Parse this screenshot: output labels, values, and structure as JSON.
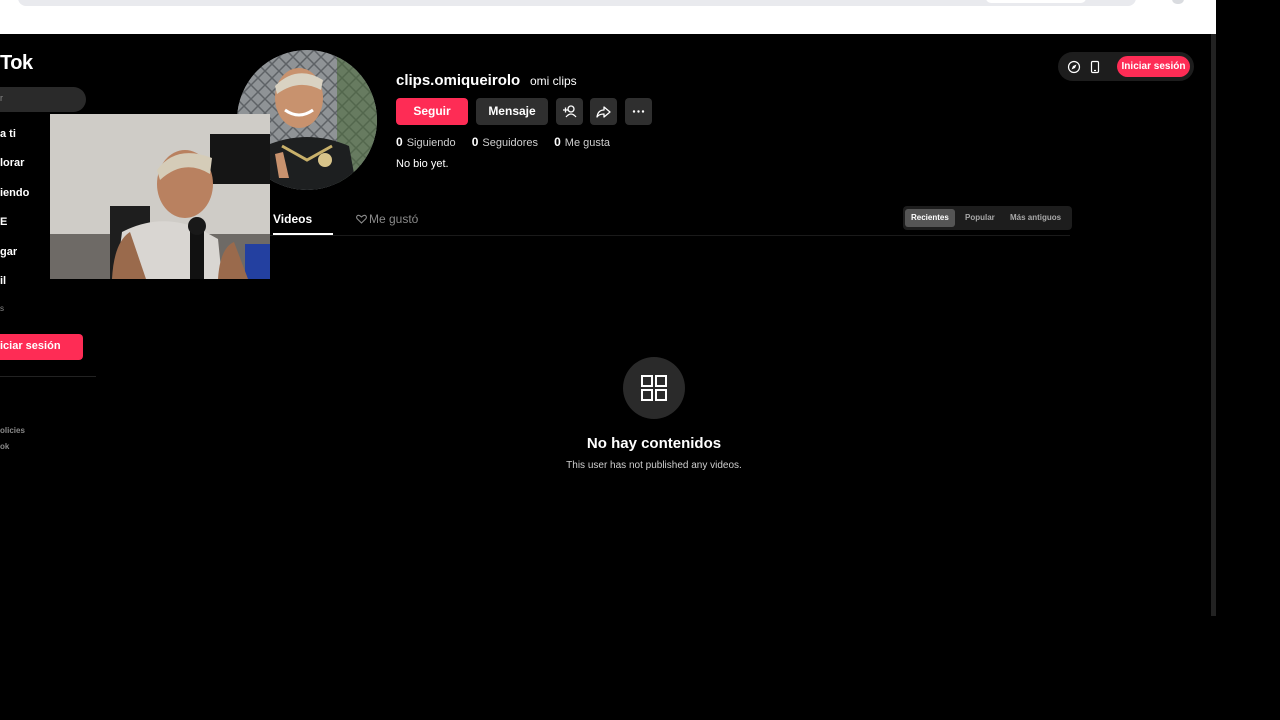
{
  "sidebar": {
    "logo": "Tok",
    "search_placeholder": "r",
    "items": [
      {
        "label": "a ti"
      },
      {
        "label": "lorar"
      },
      {
        "label": "iendo"
      },
      {
        "label": "E"
      },
      {
        "label": "gar"
      },
      {
        "label": "il"
      },
      {
        "label": "s"
      }
    ],
    "login_label": "iciar sesión",
    "footer": [
      {
        "label": "olicies"
      },
      {
        "label": "ok"
      }
    ]
  },
  "profile": {
    "username": "clips.omiqueirolo",
    "nickname": "omi clips",
    "follow_label": "Seguir",
    "message_label": "Mensaje",
    "stats": [
      {
        "value": "0",
        "label": "Siguiendo"
      },
      {
        "value": "0",
        "label": "Seguidores"
      },
      {
        "value": "0",
        "label": "Me gusta"
      }
    ],
    "bio": "No bio yet."
  },
  "header": {
    "login_label": "Iniciar sesión"
  },
  "tabs": [
    {
      "label": "Videos"
    },
    {
      "label": "Me gustó"
    }
  ],
  "sort": [
    {
      "label": "Recientes",
      "selected": true
    },
    {
      "label": "Popular",
      "selected": false
    },
    {
      "label": "Más antiguos",
      "selected": false
    }
  ],
  "empty": {
    "title": "No hay contenidos",
    "subtitle": "This user has not published any videos."
  },
  "colors": {
    "accent": "#fe2c55",
    "background": "#000000",
    "surface": "#2f2f2f"
  },
  "icons": [
    "compass-icon",
    "phone-icon",
    "add-friend-icon",
    "share-icon",
    "more-icon",
    "grid-icon",
    "heart-outline-icon"
  ]
}
